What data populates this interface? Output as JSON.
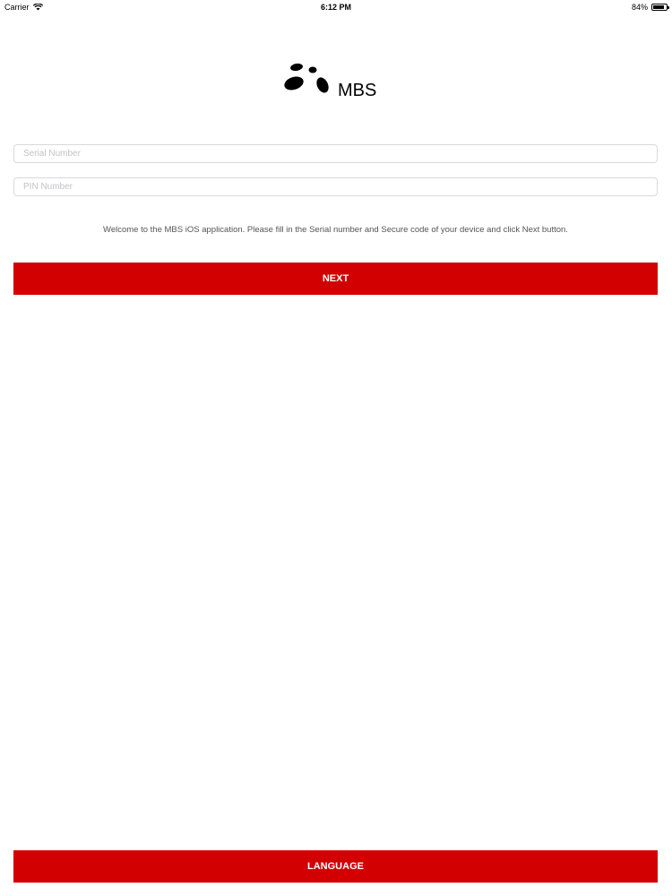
{
  "status_bar": {
    "carrier": "Carrier",
    "time": "6:12 PM",
    "battery": "84%",
    "battery_level": 0.84
  },
  "logo": {
    "text": "MBS"
  },
  "form": {
    "serial_placeholder": "Serial Number",
    "serial_value": "",
    "pin_placeholder": "PIN Number",
    "pin_value": ""
  },
  "welcome_text": "Welcome to the MBS iOS application. Please fill in the Serial number and Secure code of your device and click Next button.",
  "buttons": {
    "next": "NEXT",
    "language": "LANGUAGE"
  },
  "colors": {
    "accent": "#d20000"
  }
}
